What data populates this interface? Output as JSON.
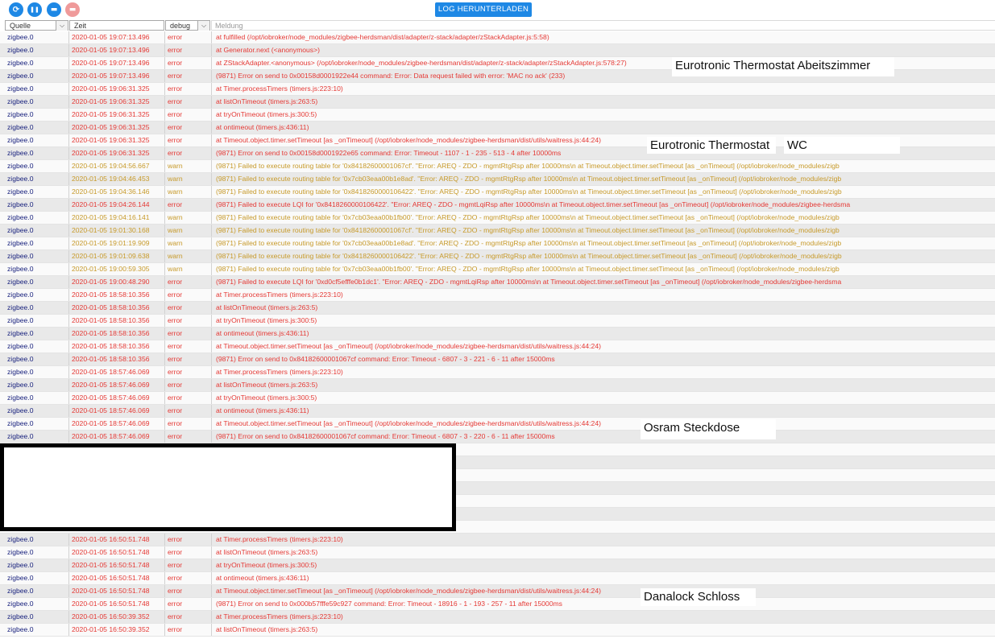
{
  "toolbar": {
    "buttons": [
      {
        "name": "refresh-icon",
        "glyph": "⟳"
      },
      {
        "name": "pause-icon",
        "glyph": "❚❚"
      },
      {
        "name": "trash-icon",
        "glyph": "▬"
      },
      {
        "name": "trash-disabled-icon",
        "glyph": "▬"
      }
    ],
    "download_label": "LOG HERUNTERLADEN"
  },
  "header": {
    "source_label": "Quelle",
    "time_label": "Zeit",
    "level_label": "debug",
    "message_label": "Meldung",
    "dropdown_glyph": "⌵"
  },
  "rows_top": [
    {
      "source": "zigbee.0",
      "time": "2020-01-05 19:07:13.496",
      "level": "error",
      "message": "at fulfilled (/opt/iobroker/node_modules/zigbee-herdsman/dist/adapter/z-stack/adapter/zStackAdapter.js:5:58)"
    },
    {
      "source": "zigbee.0",
      "time": "2020-01-05 19:07:13.496",
      "level": "error",
      "message": "at Generator.next (<anonymous>)"
    },
    {
      "source": "zigbee.0",
      "time": "2020-01-05 19:07:13.496",
      "level": "error",
      "message": "at ZStackAdapter.<anonymous> (/opt/iobroker/node_modules/zigbee-herdsman/dist/adapter/z-stack/adapter/zStackAdapter.js:578:27)"
    },
    {
      "source": "zigbee.0",
      "time": "2020-01-05 19:07:13.496",
      "level": "error",
      "message": "(9871) Error on send to 0x00158d0001922e44 command: Error: Data request failed with error: 'MAC no ack' (233)"
    },
    {
      "source": "zigbee.0",
      "time": "2020-01-05 19:06:31.325",
      "level": "error",
      "message": "at Timer.processTimers (timers.js:223:10)"
    },
    {
      "source": "zigbee.0",
      "time": "2020-01-05 19:06:31.325",
      "level": "error",
      "message": "at listOnTimeout (timers.js:263:5)"
    },
    {
      "source": "zigbee.0",
      "time": "2020-01-05 19:06:31.325",
      "level": "error",
      "message": "at tryOnTimeout (timers.js:300:5)"
    },
    {
      "source": "zigbee.0",
      "time": "2020-01-05 19:06:31.325",
      "level": "error",
      "message": "at ontimeout (timers.js:436:11)"
    },
    {
      "source": "zigbee.0",
      "time": "2020-01-05 19:06:31.325",
      "level": "error",
      "message": "at Timeout.object.timer.setTimeout [as _onTimeout] (/opt/iobroker/node_modules/zigbee-herdsman/dist/utils/waitress.js:44:24)"
    },
    {
      "source": "zigbee.0",
      "time": "2020-01-05 19:06:31.325",
      "level": "error",
      "message": "(9871) Error on send to 0x00158d0001922e65 command: Error: Timeout - 1107 - 1 - 235 - 513 - 4 after 10000ms"
    },
    {
      "source": "zigbee.0",
      "time": "2020-01-05 19:04:56.667",
      "level": "warn",
      "message": "(9871) Failed to execute routing table for '0x84182600001067cf'. \"Error: AREQ - ZDO - mgmtRtgRsp after 10000ms\\n at Timeout.object.timer.setTimeout [as _onTimeout] (/opt/iobroker/node_modules/zigb"
    },
    {
      "source": "zigbee.0",
      "time": "2020-01-05 19:04:46.453",
      "level": "warn",
      "message": "(9871) Failed to execute routing table for '0x7cb03eaa00b1e8ad'. \"Error: AREQ - ZDO - mgmtRtgRsp after 10000ms\\n at Timeout.object.timer.setTimeout [as _onTimeout] (/opt/iobroker/node_modules/zigb"
    },
    {
      "source": "zigbee.0",
      "time": "2020-01-05 19:04:36.146",
      "level": "warn",
      "message": "(9871) Failed to execute routing table for '0x8418260000106422'. \"Error: AREQ - ZDO - mgmtRtgRsp after 10000ms\\n at Timeout.object.timer.setTimeout [as _onTimeout] (/opt/iobroker/node_modules/zigb"
    },
    {
      "source": "zigbee.0",
      "time": "2020-01-05 19:04:26.144",
      "level": "error",
      "message": "(9871) Failed to execute LQI for '0x8418260000106422'. \"Error: AREQ - ZDO - mgmtLqiRsp after 10000ms\\n at Timeout.object.timer.setTimeout [as _onTimeout] (/opt/iobroker/node_modules/zigbee-herdsma"
    },
    {
      "source": "zigbee.0",
      "time": "2020-01-05 19:04:16.141",
      "level": "warn",
      "message": "(9871) Failed to execute routing table for '0x7cb03eaa00b1fb00'. \"Error: AREQ - ZDO - mgmtRtgRsp after 10000ms\\n at Timeout.object.timer.setTimeout [as _onTimeout] (/opt/iobroker/node_modules/zigb"
    },
    {
      "source": "zigbee.0",
      "time": "2020-01-05 19:01:30.168",
      "level": "warn",
      "message": "(9871) Failed to execute routing table for '0x84182600001067cf'. \"Error: AREQ - ZDO - mgmtRtgRsp after 10000ms\\n at Timeout.object.timer.setTimeout [as _onTimeout] (/opt/iobroker/node_modules/zigb"
    },
    {
      "source": "zigbee.0",
      "time": "2020-01-05 19:01:19.909",
      "level": "warn",
      "message": "(9871) Failed to execute routing table for '0x7cb03eaa00b1e8ad'. \"Error: AREQ - ZDO - mgmtRtgRsp after 10000ms\\n at Timeout.object.timer.setTimeout [as _onTimeout] (/opt/iobroker/node_modules/zigb"
    },
    {
      "source": "zigbee.0",
      "time": "2020-01-05 19:01:09.638",
      "level": "warn",
      "message": "(9871) Failed to execute routing table for '0x8418260000106422'. \"Error: AREQ - ZDO - mgmtRtgRsp after 10000ms\\n at Timeout.object.timer.setTimeout [as _onTimeout] (/opt/iobroker/node_modules/zigb"
    },
    {
      "source": "zigbee.0",
      "time": "2020-01-05 19:00:59.305",
      "level": "warn",
      "message": "(9871) Failed to execute routing table for '0x7cb03eaa00b1fb00'. \"Error: AREQ - ZDO - mgmtRtgRsp after 10000ms\\n at Timeout.object.timer.setTimeout [as _onTimeout] (/opt/iobroker/node_modules/zigb"
    },
    {
      "source": "zigbee.0",
      "time": "2020-01-05 19:00:48.290",
      "level": "error",
      "message": "(9871) Failed to execute LQI for '0xd0cf5efffe0b1dc1'. \"Error: AREQ - ZDO - mgmtLqiRsp after 10000ms\\n at Timeout.object.timer.setTimeout [as _onTimeout] (/opt/iobroker/node_modules/zigbee-herdsma"
    },
    {
      "source": "zigbee.0",
      "time": "2020-01-05 18:58:10.356",
      "level": "error",
      "message": "at Timer.processTimers (timers.js:223:10)"
    },
    {
      "source": "zigbee.0",
      "time": "2020-01-05 18:58:10.356",
      "level": "error",
      "message": "at listOnTimeout (timers.js:263:5)"
    },
    {
      "source": "zigbee.0",
      "time": "2020-01-05 18:58:10.356",
      "level": "error",
      "message": "at tryOnTimeout (timers.js:300:5)"
    },
    {
      "source": "zigbee.0",
      "time": "2020-01-05 18:58:10.356",
      "level": "error",
      "message": "at ontimeout (timers.js:436:11)"
    },
    {
      "source": "zigbee.0",
      "time": "2020-01-05 18:58:10.356",
      "level": "error",
      "message": "at Timeout.object.timer.setTimeout [as _onTimeout] (/opt/iobroker/node_modules/zigbee-herdsman/dist/utils/waitress.js:44:24)"
    },
    {
      "source": "zigbee.0",
      "time": "2020-01-05 18:58:10.356",
      "level": "error",
      "message": "(9871) Error on send to 0x84182600001067cf command: Error: Timeout - 6807 - 3 - 221 - 6 - 11 after 15000ms"
    },
    {
      "source": "zigbee.0",
      "time": "2020-01-05 18:57:46.069",
      "level": "error",
      "message": "at Timer.processTimers (timers.js:223:10)"
    },
    {
      "source": "zigbee.0",
      "time": "2020-01-05 18:57:46.069",
      "level": "error",
      "message": "at listOnTimeout (timers.js:263:5)"
    },
    {
      "source": "zigbee.0",
      "time": "2020-01-05 18:57:46.069",
      "level": "error",
      "message": "at tryOnTimeout (timers.js:300:5)"
    },
    {
      "source": "zigbee.0",
      "time": "2020-01-05 18:57:46.069",
      "level": "error",
      "message": "at ontimeout (timers.js:436:11)"
    },
    {
      "source": "zigbee.0",
      "time": "2020-01-05 18:57:46.069",
      "level": "error",
      "message": "at Timeout.object.timer.setTimeout [as _onTimeout] (/opt/iobroker/node_modules/zigbee-herdsman/dist/utils/waitress.js:44:24)"
    },
    {
      "source": "zigbee.0",
      "time": "2020-01-05 18:57:46.069",
      "level": "error",
      "message": "(9871) Error on send to 0x84182600001067cf command: Error: Timeout - 6807 - 3 - 220 - 6 - 11 after 15000ms"
    }
  ],
  "rows_bottom": [
    {
      "source": "zigbee.0",
      "time": "2020-01-05 16:50:51.748",
      "level": "error",
      "message": "at Timer.processTimers (timers.js:223:10)"
    },
    {
      "source": "zigbee.0",
      "time": "2020-01-05 16:50:51.748",
      "level": "error",
      "message": "at listOnTimeout (timers.js:263:5)"
    },
    {
      "source": "zigbee.0",
      "time": "2020-01-05 16:50:51.748",
      "level": "error",
      "message": "at tryOnTimeout (timers.js:300:5)"
    },
    {
      "source": "zigbee.0",
      "time": "2020-01-05 16:50:51.748",
      "level": "error",
      "message": "at ontimeout (timers.js:436:11)"
    },
    {
      "source": "zigbee.0",
      "time": "2020-01-05 16:50:51.748",
      "level": "error",
      "message": "at Timeout.object.timer.setTimeout [as _onTimeout] (/opt/iobroker/node_modules/zigbee-herdsman/dist/utils/waitress.js:44:24)"
    },
    {
      "source": "zigbee.0",
      "time": "2020-01-05 16:50:51.748",
      "level": "error",
      "message": "(9871) Error on send to 0x000b57fffe59c927 command: Error: Timeout - 18916 - 1 - 193 - 257 - 11 after 15000ms"
    },
    {
      "source": "zigbee.0",
      "time": "2020-01-05 16:50:39.352",
      "level": "error",
      "message": "at Timer.processTimers (timers.js:223:10)"
    },
    {
      "source": "zigbee.0",
      "time": "2020-01-05 16:50:39.352",
      "level": "error",
      "message": "at listOnTimeout (timers.js:263:5)"
    }
  ],
  "annotations": {
    "note1": "Eurotronic Thermostat Abeitszimmer",
    "note2a": "Eurotronic Thermostat",
    "note2b": "WC",
    "note3": "Osram Steckdose",
    "note4": "Danalock Schloss"
  }
}
